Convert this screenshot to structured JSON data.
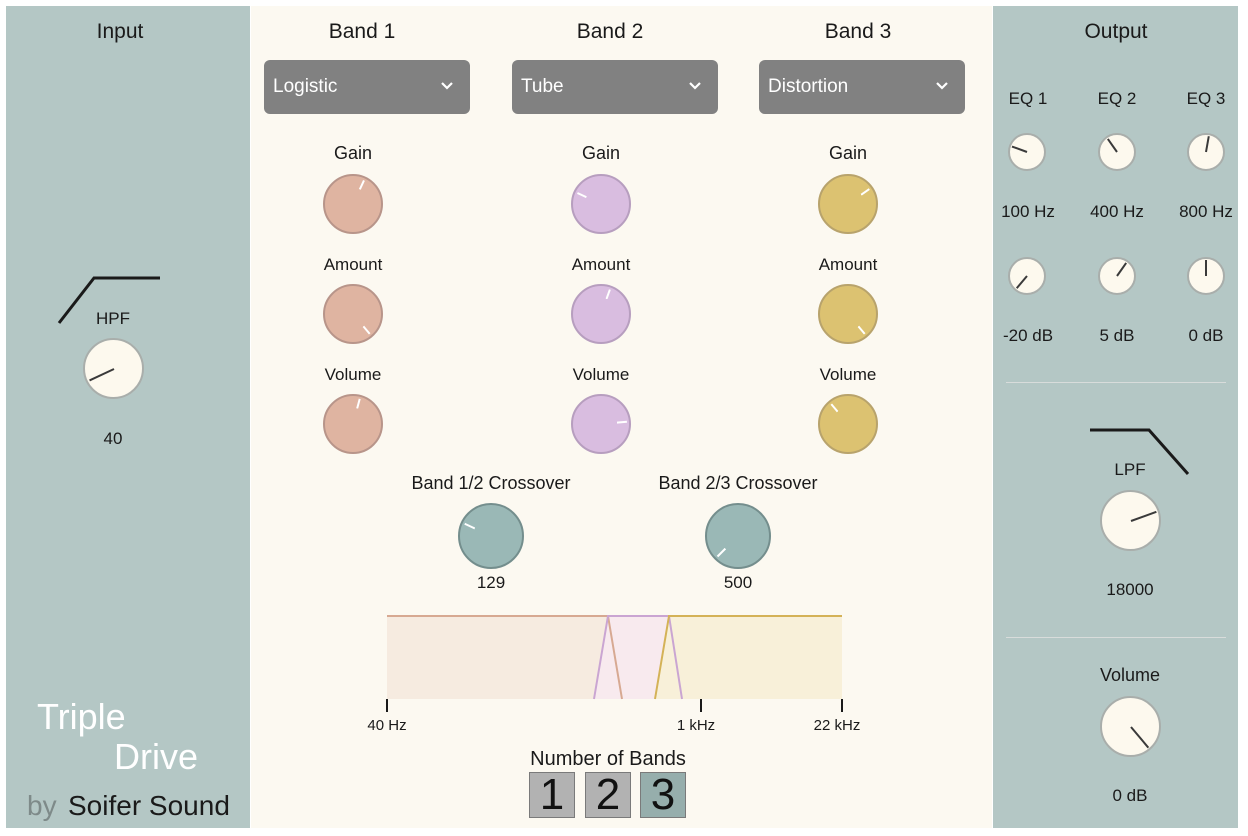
{
  "input": {
    "title": "Input",
    "hpf_label": "HPF",
    "hpf_value": "40"
  },
  "branding": {
    "line1": "Triple",
    "line2": "Drive",
    "by": "by",
    "company": "Soifer Sound"
  },
  "bands": [
    {
      "title": "Band 1",
      "mode": "Logistic",
      "gain_label": "Gain",
      "amount_label": "Amount",
      "volume_label": "Volume",
      "color": "#dfb4a1"
    },
    {
      "title": "Band 2",
      "mode": "Tube",
      "gain_label": "Gain",
      "amount_label": "Amount",
      "volume_label": "Volume",
      "color": "#d9bde0"
    },
    {
      "title": "Band 3",
      "mode": "Distortion",
      "gain_label": "Gain",
      "amount_label": "Amount",
      "volume_label": "Volume",
      "color": "#dcc271"
    }
  ],
  "crossovers": [
    {
      "label": "Band 1/2 Crossover",
      "value": "129"
    },
    {
      "label": "Band 2/3 Crossover",
      "value": "500"
    }
  ],
  "spectrum": {
    "tick_labels": [
      "40 Hz",
      "1 kHz",
      "22 kHz"
    ]
  },
  "band_selector": {
    "title": "Number of Bands",
    "options": [
      "1",
      "2",
      "3"
    ],
    "selected": "3"
  },
  "output": {
    "title": "Output",
    "eq": [
      {
        "label": "EQ 1",
        "freq": "100 Hz",
        "gain": "-20 dB"
      },
      {
        "label": "EQ 2",
        "freq": "400 Hz",
        "gain": "5 dB"
      },
      {
        "label": "EQ 3",
        "freq": "800 Hz",
        "gain": "0 dB"
      }
    ],
    "lpf_label": "LPF",
    "lpf_value": "18000",
    "volume_label": "Volume",
    "volume_value": "0 dB"
  },
  "colors": {
    "side_panel": "#b4c7c5",
    "main_panel": "#fcf9f1",
    "band1": "#dfb4a1",
    "band2": "#d9bde0",
    "band3": "#dcc271",
    "crossover": "#9ab8b6",
    "dropdown": "#818181"
  }
}
